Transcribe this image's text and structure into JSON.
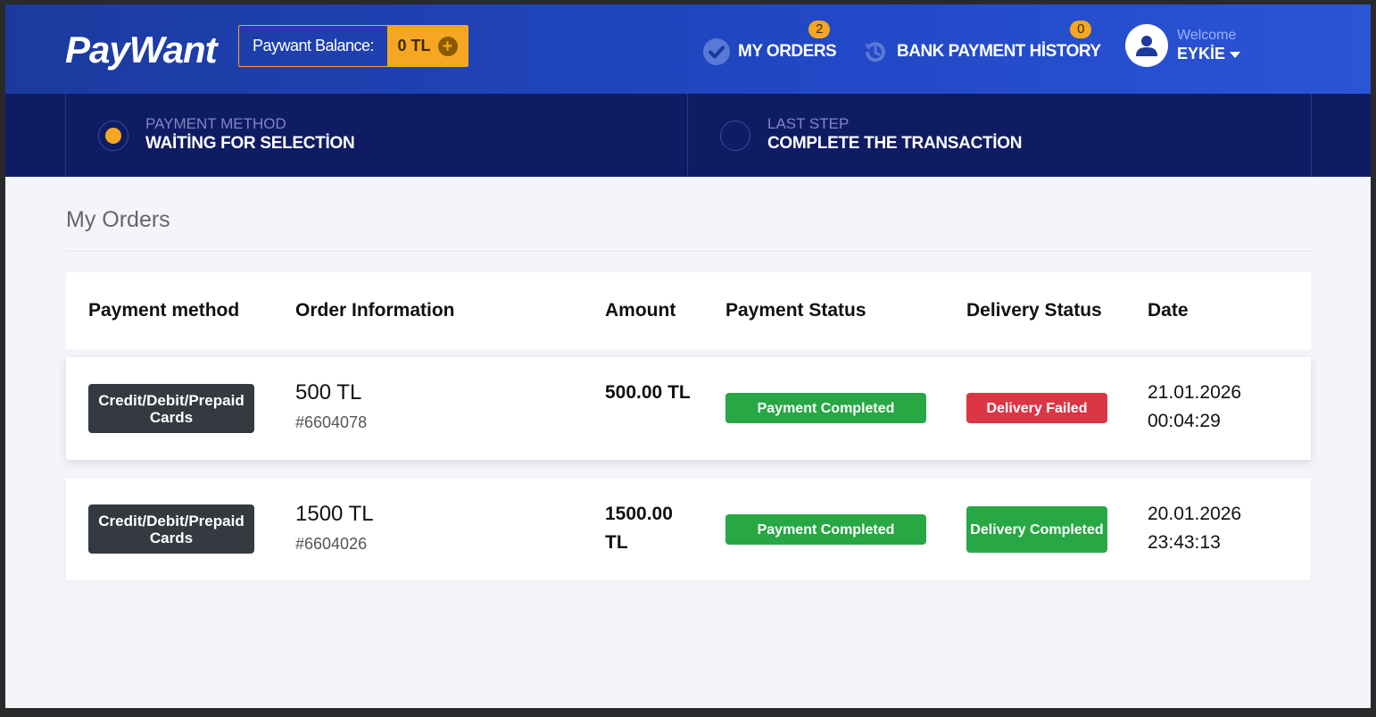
{
  "header": {
    "logo": "PayWant",
    "balance_label": "Paywant Balance:",
    "balance_value": "0 TL",
    "nav": [
      {
        "label": "MY ORDERS",
        "badge": "2",
        "icon": "check-circle-icon"
      },
      {
        "label": "BANK PAYMENT HİSTORY",
        "badge": "0",
        "icon": "history-icon"
      }
    ],
    "user": {
      "welcome": "Welcome",
      "name": "EYKİE",
      "icon": "user-icon"
    }
  },
  "steps": [
    {
      "sub": "PAYMENT METHOD",
      "main": "WAİTİNG FOR SELECTİON",
      "active": true
    },
    {
      "sub": "LAST STEP",
      "main": "COMPLETE THE TRANSACTİON",
      "active": false
    }
  ],
  "page": {
    "title": "My Orders"
  },
  "table": {
    "columns": [
      "Payment method",
      "Order Information",
      "Amount",
      "Payment Status",
      "Delivery Status",
      "Date"
    ],
    "rows": [
      {
        "method": "Credit/Debit/Prepaid Cards",
        "order_amount": "500 TL",
        "order_id": "#6604078",
        "amount": "500.00 TL",
        "payment_status": "Payment Completed",
        "delivery_status": "Delivery Failed",
        "date": "21.01.2026",
        "time": "00:04:29"
      },
      {
        "method": "Credit/Debit/Prepaid Cards",
        "order_amount": "1500 TL",
        "order_id": "#6604026",
        "amount": "1500.00 TL",
        "payment_status": "Payment Completed",
        "delivery_status": "Delivery Completed",
        "date": "20.01.2026",
        "time": "23:43:13"
      }
    ]
  },
  "colors": {
    "header_blue": "#2148c6",
    "steps_navy": "#0f1c63",
    "accent_orange": "#f5a623",
    "success_green": "#28a745",
    "danger_red": "#dc3545",
    "method_dark": "#343a40"
  }
}
